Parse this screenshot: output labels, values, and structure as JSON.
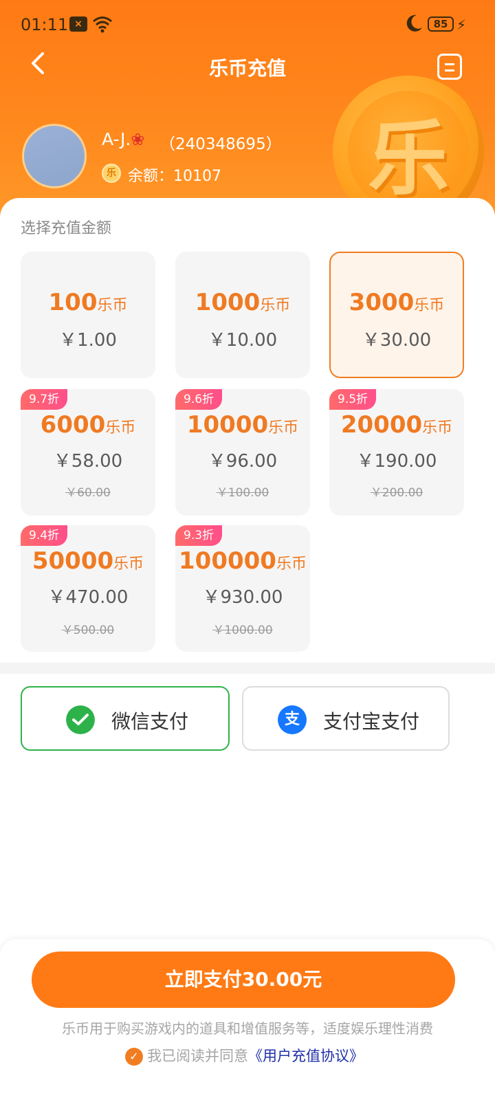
{
  "status_bar": {
    "time": "01:11",
    "battery": "85"
  },
  "nav": {
    "title": "乐币充值"
  },
  "user": {
    "name": "A-J.",
    "uid": "（240348695）",
    "balance_label": "余额：",
    "balance": "10107",
    "coin_icon_text": "乐"
  },
  "coin_art_text": "乐",
  "section_label": "选择充值金额",
  "unit": "乐币",
  "packages": [
    {
      "coins": "100",
      "price": "￥1.00",
      "selected": false
    },
    {
      "coins": "1000",
      "price": "￥10.00",
      "selected": false
    },
    {
      "coins": "3000",
      "price": "￥30.00",
      "selected": true
    },
    {
      "coins": "6000",
      "price": "￥58.00",
      "original": "￥60.00",
      "discount": "9.7折"
    },
    {
      "coins": "10000",
      "price": "￥96.00",
      "original": "￥100.00",
      "discount": "9.6折"
    },
    {
      "coins": "20000",
      "price": "￥190.00",
      "original": "￥200.00",
      "discount": "9.5折"
    },
    {
      "coins": "50000",
      "price": "￥470.00",
      "original": "￥500.00",
      "discount": "9.4折"
    },
    {
      "coins": "100000",
      "price": "￥930.00",
      "original": "￥1000.00",
      "discount": "9.3折"
    }
  ],
  "payment": {
    "wechat_label": "微信支付",
    "alipay_label": "支付宝支付",
    "alipay_icon_text": "支",
    "selected": "wechat"
  },
  "footer": {
    "pay_button": "立即支付30.00元",
    "note": "乐币用于购买游戏内的道具和增值服务等，适度娱乐理性消费",
    "agree_text": "我已阅读并同意",
    "agreement_link": "《用户充值协议》"
  },
  "colors": {
    "accent": "#ff7a14",
    "price_orange": "#ef7a22",
    "wechat_green": "#2db24a",
    "alipay_blue": "#1677ff",
    "badge_pink": "#ff5a7a"
  }
}
